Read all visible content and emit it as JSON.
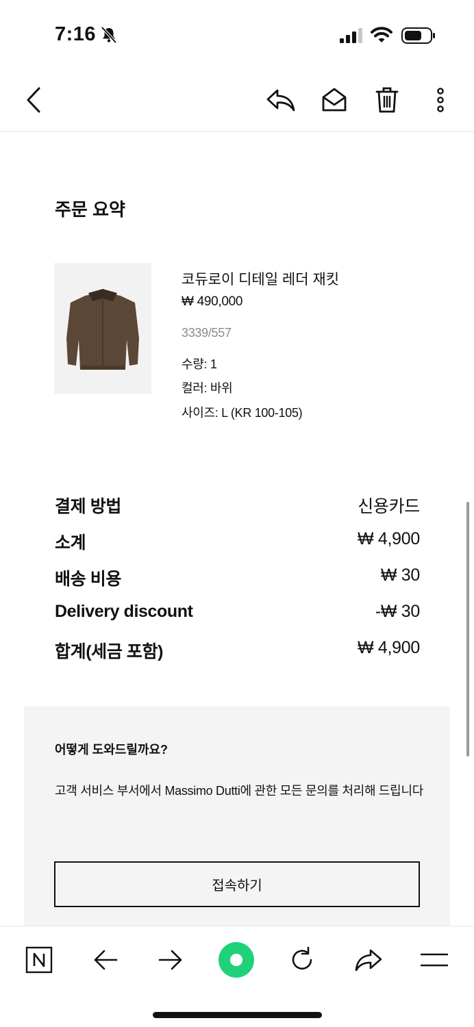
{
  "status_bar": {
    "time": "7:16"
  },
  "toolbar": {
    "icons": [
      "back-icon",
      "reply-icon",
      "envelope-open-icon",
      "trash-icon",
      "more-vertical-icon"
    ]
  },
  "order_summary": {
    "title": "주문 요약",
    "product": {
      "name": "코듀로이 디테일 레더 재킷",
      "price": "₩ 490,000",
      "reference": "3339/557",
      "quantity": "수량: 1",
      "color": "컬러: 바위",
      "size": "사이즈: L (KR 100-105)"
    }
  },
  "summary": {
    "rows": [
      {
        "label": "결제 방법",
        "value": "신용카드"
      },
      {
        "label": "소계",
        "value": "₩ 4,900"
      },
      {
        "label": "배송 비용",
        "value": "₩ 30"
      },
      {
        "label": "Delivery discount",
        "value": "-₩ 30"
      },
      {
        "label": "합계(세금 포함)",
        "value": "₩ 4,900"
      }
    ]
  },
  "help": {
    "title": "어떻게 도와드릴까요?",
    "text": "고객 서비스 부서에서 Massimo Dutti에 관한 모든 문의를 처리해 드립니다",
    "button_label": "접속하기"
  },
  "browser_bar": {
    "icons": [
      "naver-n-icon",
      "arrow-left-icon",
      "arrow-right-icon",
      "green-circle-icon",
      "refresh-icon",
      "share-icon",
      "menu-icon"
    ],
    "accent_color": "#1fd27a"
  }
}
